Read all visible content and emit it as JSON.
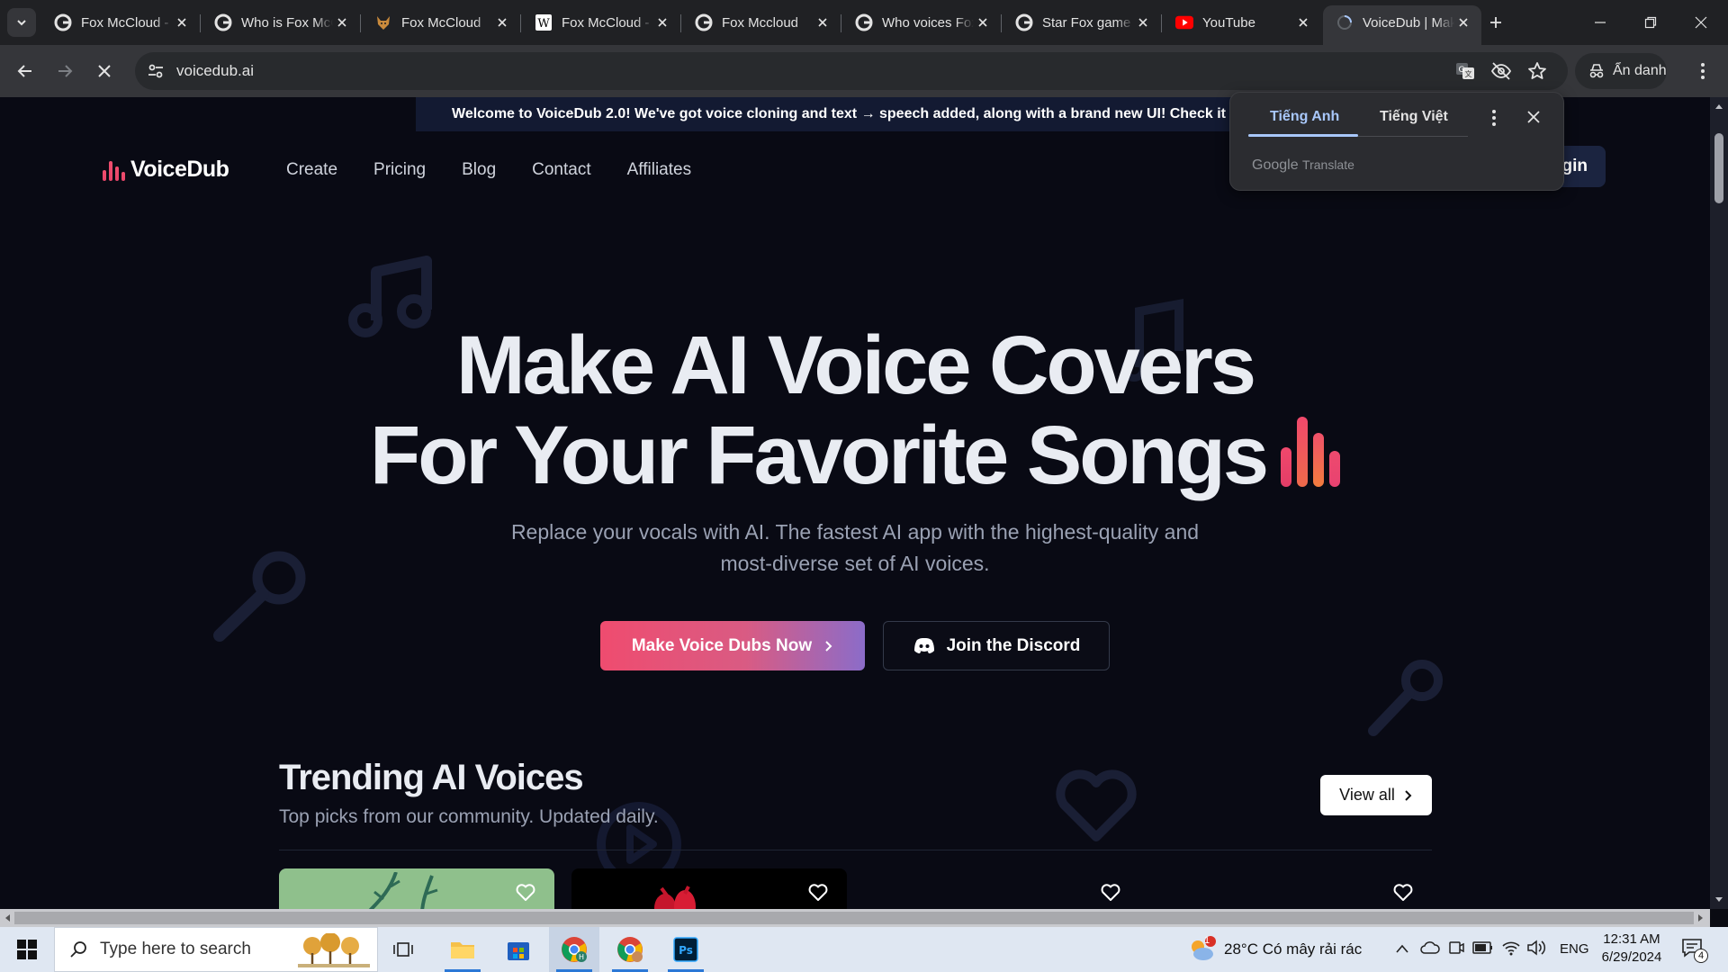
{
  "browser": {
    "tabs": [
      {
        "title": "Fox McCloud - Google Search",
        "favicon": "google-icon"
      },
      {
        "title": "Who is Fox McCloud",
        "favicon": "google-icon"
      },
      {
        "title": "Fox McCloud",
        "favicon": "fox-icon"
      },
      {
        "title": "Fox McCloud - Wikipedia",
        "favicon": "wikipedia-icon"
      },
      {
        "title": "Fox Mccloud",
        "favicon": "google-icon"
      },
      {
        "title": "Who voices Fox",
        "favicon": "google-icon"
      },
      {
        "title": "Star Fox game",
        "favicon": "google-icon"
      },
      {
        "title": "YouTube",
        "favicon": "youtube-icon"
      },
      {
        "title": "VoiceDub | Make AI",
        "favicon": "loading-icon",
        "active": true
      }
    ],
    "url": "voicedub.ai",
    "incognito_label": "Ẩn danh"
  },
  "translate_popup": {
    "source_lang": "Tiếng Anh",
    "target_lang": "Tiếng Việt",
    "footer_brand": "Google",
    "footer_product": "Translate"
  },
  "site": {
    "announcement": "Welcome to VoiceDub 2.0! We've got voice cloning and text → speech added, along with a brand new UI! Check it out here",
    "logo": "VoiceDub",
    "nav": [
      "Create",
      "Pricing",
      "Blog",
      "Contact",
      "Affiliates"
    ],
    "login": "Login",
    "hero_line1": "Make AI Voice Covers",
    "hero_line2": "For Your Favorite Songs",
    "hero_sub_line1": "Replace your vocals with AI. The fastest AI app with the highest-quality and",
    "hero_sub_line2": "most-diverse set of AI voices.",
    "cta_primary": "Make Voice Dubs Now",
    "cta_secondary": "Join the Discord",
    "trending_title": "Trending AI Voices",
    "trending_sub": "Top picks from our community. Updated daily.",
    "view_all": "View all"
  },
  "taskbar": {
    "search_placeholder": "Type here to search",
    "weather": "28°C  Có mây rải rác",
    "weather_badge": "1",
    "lang": "ENG",
    "time": "12:31 AM",
    "date": "6/29/2024",
    "notif_count": "4"
  },
  "colors": {
    "accent_pink": "#ef4c6f",
    "accent_purple": "#8b6cc9",
    "page_bg": "#090a14"
  }
}
